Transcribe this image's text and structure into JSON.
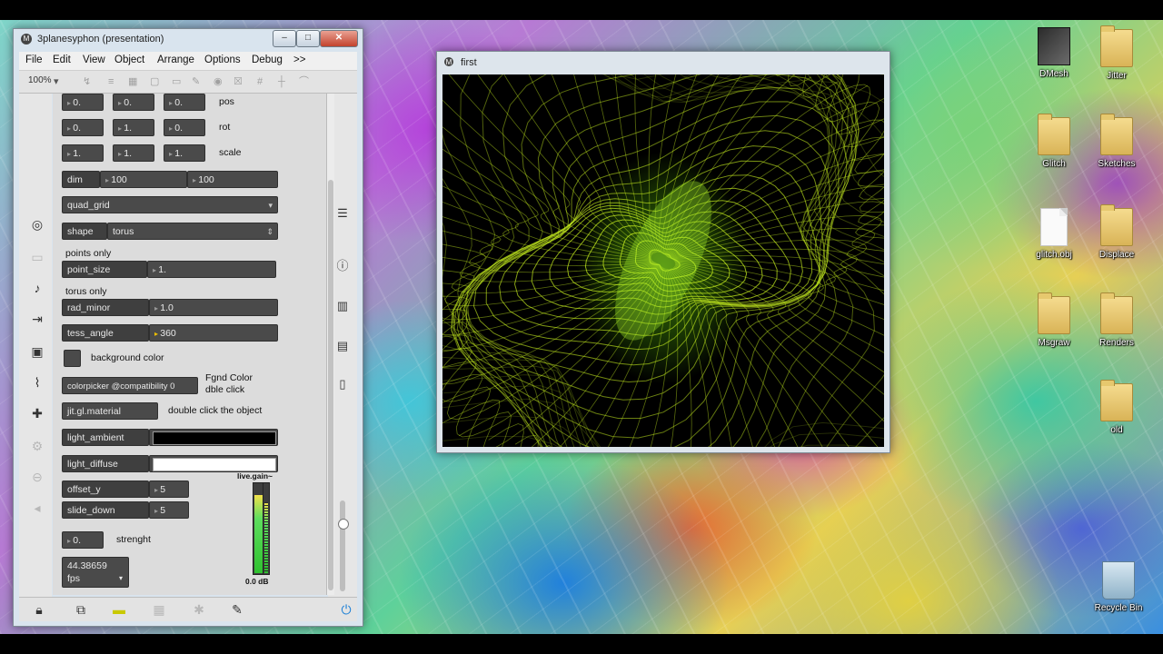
{
  "desktop": {
    "icons": [
      {
        "label": "DMesh",
        "kind": "app"
      },
      {
        "label": "Jitter",
        "kind": "folder"
      },
      {
        "label": "Glitch",
        "kind": "folder"
      },
      {
        "label": "Sketches",
        "kind": "folder"
      },
      {
        "label": "glitch.obj",
        "kind": "file"
      },
      {
        "label": "Displace",
        "kind": "folder"
      },
      {
        "label": "Msgraw",
        "kind": "folder"
      },
      {
        "label": "Renders",
        "kind": "folder"
      },
      {
        "label": "old",
        "kind": "folder"
      },
      {
        "label": "Recycle Bin",
        "kind": "bin"
      }
    ]
  },
  "patcher": {
    "title": "3planesyphon (presentation)",
    "menu": [
      "File",
      "Edit",
      "View",
      "Object",
      "Arrange",
      "Options",
      "Debug",
      ">>"
    ],
    "zoom": "100%",
    "rows": {
      "pos": {
        "values": [
          "0.",
          "0.",
          "0."
        ],
        "label": "pos"
      },
      "rot": {
        "values": [
          "0.",
          "1.",
          "0."
        ],
        "label": "rot"
      },
      "scale": {
        "values": [
          "1.",
          "1.",
          "1."
        ],
        "label": "scale"
      }
    },
    "dim": {
      "label": "dim",
      "x": "100",
      "y": "100"
    },
    "draw_mode": "quad_grid",
    "shape": {
      "label": "shape",
      "value": "torus"
    },
    "points_only_label": "points only",
    "point_size": {
      "label": "point_size",
      "value": "1."
    },
    "torus_only_label": "torus only",
    "rad_minor": {
      "label": "rad_minor",
      "value": "1.0"
    },
    "tess_angle": {
      "label": "tess_angle",
      "value": "360"
    },
    "background_color_label": "background color",
    "colorpicker": "colorpicker @compatibility 0",
    "fgnd_label_1": "Fgnd Color",
    "fgnd_label_2": "dble click",
    "gl_material": "jit.gl.material",
    "gl_material_hint": "double click the object",
    "light_ambient": "light_ambient",
    "light_diffuse": "light_diffuse",
    "offset_y": {
      "label": "offset_y",
      "value": "5"
    },
    "slide_down": {
      "label": "slide_down",
      "value": "5"
    },
    "strength": {
      "value": "0.",
      "label": "strenght"
    },
    "fps": {
      "value": "44.38659",
      "unit": "fps"
    },
    "live_gain": {
      "label": "live.gain~",
      "readout": "0.0 dB"
    }
  },
  "render": {
    "title": "first"
  },
  "colors": {
    "mesh": "#c8f020",
    "object": "#4a4a4a"
  }
}
